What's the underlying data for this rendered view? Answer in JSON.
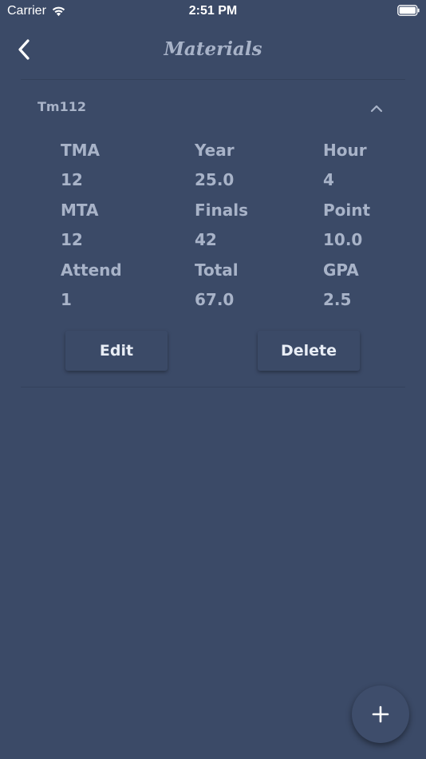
{
  "status_bar": {
    "carrier": "Carrier",
    "time": "2:51 PM"
  },
  "nav": {
    "title": "Materials",
    "back_icon": "chevron-left-icon"
  },
  "material": {
    "name": "Tm112",
    "expanded": true,
    "fields": {
      "tma_label": "TMA",
      "tma_value": "12",
      "year_label": "Year",
      "year_value": "25.0",
      "hour_label": "Hour",
      "hour_value": "4",
      "mta_label": "MTA",
      "mta_value": "12",
      "finals_label": "Finals",
      "finals_value": "42",
      "point_label": "Point",
      "point_value": "10.0",
      "attend_label": "Attend",
      "attend_value": "1",
      "total_label": "Total",
      "total_value": "67.0",
      "gpa_label": "GPA",
      "gpa_value": "2.5"
    },
    "edit_label": "Edit",
    "delete_label": "Delete"
  },
  "fab": {
    "icon": "plus-icon"
  },
  "colors": {
    "background": "#3b4a67",
    "text_muted": "#a8b3c8",
    "text_bright": "#ffffff"
  }
}
